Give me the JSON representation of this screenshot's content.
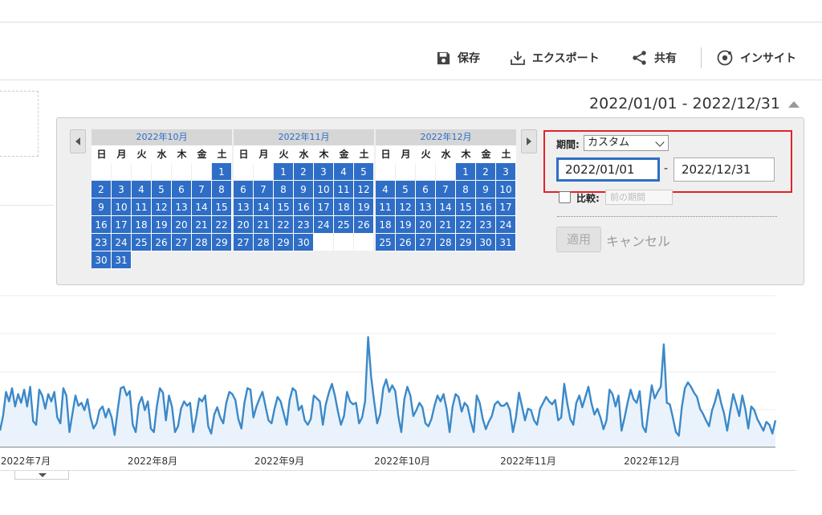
{
  "toolbar": {
    "save_label": "保存",
    "export_label": "エクスポート",
    "share_label": "共有",
    "insight_label": "インサイト"
  },
  "date_range_title": "2022/01/01 - 2022/12/31",
  "datepicker": {
    "weekdays": [
      "日",
      "月",
      "火",
      "水",
      "木",
      "金",
      "土"
    ],
    "months": [
      {
        "title": "2022年10月",
        "first_weekday": 6,
        "days": 31
      },
      {
        "title": "2022年11月",
        "first_weekday": 2,
        "days": 30
      },
      {
        "title": "2022年12月",
        "first_weekday": 4,
        "days": 31
      }
    ],
    "period_label": "期間:",
    "period_value": "カスタム",
    "start_date": "2022/01/01",
    "end_date": "2022/12/31",
    "dash": "-",
    "compare_label": "比較:",
    "compare_value": "前の期間",
    "apply_label": "適用",
    "cancel_label": "キャンセル"
  },
  "colors": {
    "accent": "#2f6ec6",
    "highlight_box": "#e0232b",
    "line": "#3b89c9",
    "area": "#eaf3fb"
  },
  "chart_data": {
    "type": "area",
    "title": "",
    "x_labels": [
      "2022年7月",
      "2022年8月",
      "2022年9月",
      "2022年10月",
      "2022年11月",
      "2022年12月"
    ],
    "grid": true,
    "ylim": [
      0,
      100
    ],
    "values": [
      22,
      42,
      75,
      62,
      80,
      55,
      72,
      60,
      78,
      55,
      82,
      35,
      30,
      78,
      70,
      52,
      72,
      62,
      75,
      40,
      32,
      80,
      70,
      20,
      45,
      70,
      56,
      60,
      50,
      65,
      40,
      25,
      32,
      50,
      55,
      40,
      52,
      40,
      16,
      50,
      80,
      82,
      70,
      76,
      30,
      20,
      58,
      68,
      50,
      62,
      25,
      20,
      56,
      80,
      74,
      36,
      70,
      55,
      20,
      28,
      52,
      62,
      56,
      60,
      20,
      40,
      66,
      62,
      70,
      28,
      18,
      44,
      54,
      40,
      32,
      60,
      75,
      72,
      64,
      38,
      25,
      60,
      80,
      78,
      40,
      55,
      66,
      75,
      55,
      36,
      32,
      52,
      68,
      62,
      46,
      30,
      64,
      80,
      76,
      50,
      56,
      36,
      30,
      38,
      70,
      66,
      62,
      30,
      58,
      74,
      86,
      70,
      48,
      30,
      42,
      75,
      62,
      58,
      60,
      32,
      40,
      62,
      150,
      96,
      62,
      32,
      45,
      80,
      92,
      75,
      84,
      76,
      42,
      20,
      65,
      82,
      70,
      42,
      50,
      60,
      54,
      32,
      28,
      38,
      56,
      70,
      62,
      72,
      52,
      20,
      55,
      72,
      68,
      48,
      60,
      55,
      35,
      20,
      70,
      60,
      38,
      24,
      34,
      42,
      58,
      62,
      56,
      56,
      60,
      50,
      20,
      40,
      74,
      55,
      36,
      52,
      50,
      36,
      30,
      52,
      60,
      68,
      62,
      58,
      64,
      36,
      40,
      86,
      60,
      38,
      30,
      60,
      70,
      54,
      68,
      82,
      60,
      44,
      52,
      40,
      24,
      36,
      78,
      72,
      55,
      70,
      22,
      40,
      60,
      78,
      65,
      60,
      76,
      28,
      20,
      52,
      84,
      66,
      75,
      82,
      140,
      60,
      58,
      40,
      20,
      15,
      55,
      80,
      88,
      82,
      74,
      68,
      52,
      45,
      36,
      28,
      50,
      62,
      78,
      60,
      45,
      22,
      48,
      72,
      58,
      42,
      70,
      52,
      25,
      55,
      50,
      38,
      30,
      22,
      34,
      30,
      18,
      36
    ]
  }
}
